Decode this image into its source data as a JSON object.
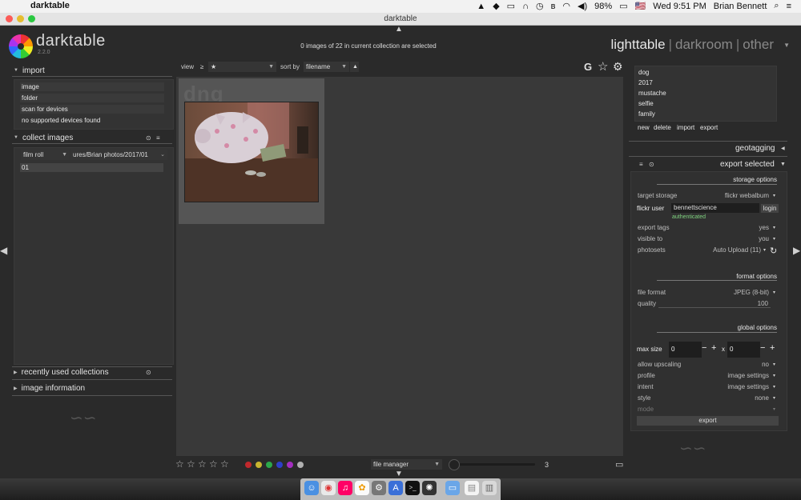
{
  "menubar": {
    "app_name": "darktable",
    "battery": "98%",
    "flag": "🇺🇸",
    "clock": "Wed 9:51 PM",
    "user": "Brian Bennett"
  },
  "window": {
    "title": "darktable"
  },
  "header": {
    "brand": "darktable",
    "version": "2.2.0",
    "selection_info": "0 images of 22 in current collection are selected",
    "views": {
      "lighttable": "lighttable",
      "darkroom": "darkroom",
      "other": "other",
      "separator": "|"
    }
  },
  "import": {
    "title": "import",
    "items": [
      "image",
      "folder",
      "scan for devices",
      "no supported devices found"
    ]
  },
  "collect": {
    "title": "collect images",
    "property": "film roll",
    "path": "ures/Brian photos/2017/01",
    "rolls": [
      "01"
    ]
  },
  "recent": {
    "title": "recently used collections"
  },
  "image_info": {
    "title": "image information"
  },
  "toolbar": {
    "view_label": "view",
    "comparator": "≥",
    "rating_filter": "★",
    "sort_label": "sort by",
    "sort_value": "filename",
    "sort_dir": "▲",
    "grouping": "G"
  },
  "thumbnail": {
    "extension_watermark": "dng"
  },
  "bottom": {
    "stars": [
      "☆",
      "☆",
      "☆",
      "☆",
      "☆"
    ],
    "color_labels": [
      "#c0282c",
      "#c8b430",
      "#2ca84a",
      "#2e3fc8",
      "#a42ec0",
      "#b0b0b0"
    ],
    "layout": "file manager",
    "zoom": "3"
  },
  "tagging": {
    "tags": [
      "dog",
      "2017",
      "mustache",
      "selfie",
      "family"
    ],
    "actions": [
      "new",
      "delete",
      "import",
      "export"
    ]
  },
  "geotagging": {
    "title": "geotagging"
  },
  "export": {
    "title": "export selected",
    "storage_heading": "storage options",
    "target_storage_label": "target storage",
    "target_storage_value": "flickr webalbum",
    "flickr_user_label": "flickr user",
    "flickr_user_value": "bennettscience",
    "login_label": "login",
    "auth_status": "authenticated",
    "export_tags_label": "export tags",
    "export_tags_value": "yes",
    "visible_to_label": "visible to",
    "visible_to_value": "you",
    "photosets_label": "photosets",
    "photosets_value": "Auto Upload (11)",
    "format_heading": "format options",
    "file_format_label": "file format",
    "file_format_value": "JPEG (8-bit)",
    "quality_label": "quality",
    "quality_value": "100",
    "global_heading": "global options",
    "max_size_label": "max size",
    "max_w": "0",
    "max_h": "0",
    "x_sep": "x",
    "upscaling_label": "allow upscaling",
    "upscaling_value": "no",
    "profile_label": "profile",
    "profile_value": "image settings",
    "intent_label": "intent",
    "intent_value": "image settings",
    "style_label": "style",
    "style_value": "none",
    "mode_label": "mode",
    "export_button": "export"
  }
}
